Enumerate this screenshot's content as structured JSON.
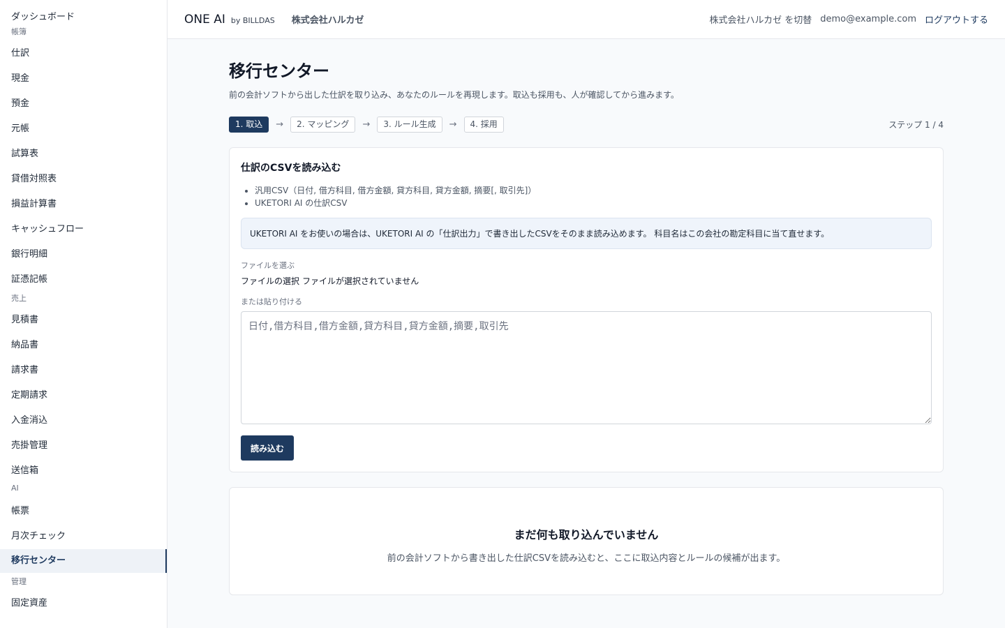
{
  "sidebar": {
    "dashboard": "ダッシュボード",
    "groups": {
      "ledger": "帳簿",
      "sales": "売上",
      "ai": "AI",
      "admin": "管理"
    },
    "items": {
      "journal": "仕訳",
      "cash": "現金",
      "deposit": "預金",
      "general_ledger": "元帳",
      "trial_balance": "試算表",
      "balance_sheet": "貸借対照表",
      "income_statement": "損益計算書",
      "cash_flow": "キャッシュフロー",
      "bank_statement": "銀行明細",
      "voucher": "証憑記帳",
      "estimate": "見積書",
      "delivery": "納品書",
      "invoice": "請求書",
      "recurring": "定期請求",
      "payment_clearing": "入金消込",
      "receivables": "売掛管理",
      "outbox": "送信箱",
      "forms": "帳票",
      "monthly_check": "月次チェック",
      "migration": "移行センター",
      "fixed_assets": "固定資産"
    }
  },
  "header": {
    "brand": "ONE AI",
    "brand_by": "by BILLDAS",
    "company": "株式会社ハルカゼ",
    "switch_label": "株式会社ハルカゼ を切替",
    "email": "demo@example.com",
    "logout": "ログアウトする"
  },
  "page": {
    "title": "移行センター",
    "description": "前の会計ソフトから出した仕訳を取り込み、あなたのルールを再現します。取込も採用も、人が確認してから進みます。",
    "steps": [
      "1. 取込",
      "2. マッピング",
      "3. ルール生成",
      "4. 採用"
    ],
    "arrow": "→",
    "step_count": "ステップ 1 / 4"
  },
  "import_card": {
    "title": "仕訳のCSVを読み込む",
    "formats": [
      "汎用CSV（日付, 借方科目, 借方金額, 貸方科目, 貸方金額, 摘要[, 取引先]）",
      "UKETORI AI の仕訳CSV"
    ],
    "notice": "UKETORI AI をお使いの場合は、UKETORI AI の「仕訳出力」で書き出したCSVをそのまま読み込めます。 科目名はこの会社の勘定科目に当て直せます。",
    "file_label": "ファイルを選ぶ",
    "file_button": "ファイルの選択",
    "file_status": "ファイルが選択されていません",
    "paste_label": "または貼り付ける",
    "paste_placeholder": "日付,借方科目,借方金額,貸方科目,貸方金額,摘要,取引先",
    "paste_value": "",
    "load_button": "読み込む"
  },
  "empty_state": {
    "title": "まだ何も取り込んでいません",
    "description": "前の会計ソフトから書き出した仕訳CSVを読み込むと、ここに取込内容とルールの候補が出ます。"
  },
  "colors": {
    "accent": "#1e3a5f",
    "notice_bg": "#eff4fb"
  }
}
